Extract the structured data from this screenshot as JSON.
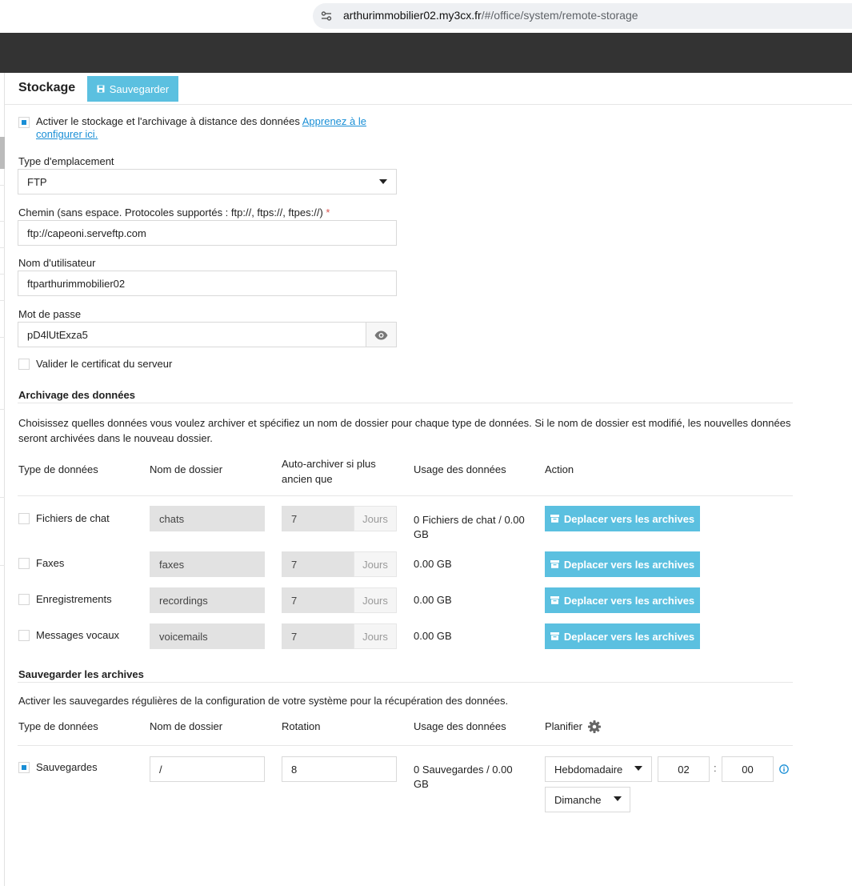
{
  "browser": {
    "url_host": "arthurimmobilier02.my3cx.fr",
    "url_path": "/#/office/system/remote-storage"
  },
  "header": {
    "title": "Stockage",
    "save_label": "Sauvegarder"
  },
  "remote": {
    "enable_label": "Activer le stockage et l'archivage à distance des données",
    "learn_link_1": "Apprenez à le",
    "learn_link_2": "configurer ici.",
    "enabled": true,
    "location_type_label": "Type d'emplacement",
    "location_type_value": "FTP",
    "path_label": "Chemin (sans espace. Protocoles supportés : ftp://, ftps://, ftpes://)",
    "path_required": "*",
    "path_value": "ftp://capeoni.serveftp.com",
    "username_label": "Nom d'utilisateur",
    "username_value": "ftparthurimmobilier02",
    "password_label": "Mot de passe",
    "password_value": "pD4lUtExza5",
    "validate_cert_label": "Valider le certificat du serveur",
    "validate_cert": false
  },
  "archiving": {
    "title": "Archivage des données",
    "description_1": "Choisissez quelles données vous voulez archiver et spécifiez un nom de dossier pour chaque type de données. Si le nom de dossier est modifié, les nouvelles données",
    "description_2": "seront archivées dans le nouveau dossier.",
    "columns": {
      "type": "Type de données",
      "folder": "Nom de dossier",
      "auto_1": "Auto-archiver si plus",
      "auto_2": "ancien que",
      "usage": "Usage des données",
      "action": "Action"
    },
    "unit": "Jours",
    "button_label": "Deplacer vers les archives",
    "rows": [
      {
        "type": "Fichiers de chat",
        "folder": "chats",
        "days": "7",
        "usage_1": "0 Fichiers de chat / 0.00",
        "usage_2": "GB",
        "checked": false
      },
      {
        "type": "Faxes",
        "folder": "faxes",
        "days": "7",
        "usage_1": "0.00 GB",
        "usage_2": "",
        "checked": false
      },
      {
        "type": "Enregistrements",
        "folder": "recordings",
        "days": "7",
        "usage_1": "0.00 GB",
        "usage_2": "",
        "checked": false
      },
      {
        "type": "Messages vocaux",
        "folder": "voicemails",
        "days": "7",
        "usage_1": "0.00 GB",
        "usage_2": "",
        "checked": false
      }
    ]
  },
  "backup": {
    "title": "Sauvegarder les archives",
    "description": "Activer les sauvegardes régulières de la configuration de votre système pour la récupération des données.",
    "columns": {
      "type": "Type de données",
      "folder": "Nom de dossier",
      "rotation": "Rotation",
      "usage": "Usage des données",
      "schedule": "Planifier"
    },
    "row": {
      "type": "Sauvegardes",
      "checked": true,
      "folder": "/",
      "rotation": "8",
      "usage_1": "0 Sauvegardes / 0.00",
      "usage_2": "GB",
      "frequency": "Hebdomadaire",
      "hour": "02",
      "separator": ":",
      "minute": "00",
      "day": "Dimanche"
    }
  },
  "colors": {
    "accent": "#5bc0e0",
    "checkbox": "#1a8fd6",
    "topbar": "#333333"
  }
}
